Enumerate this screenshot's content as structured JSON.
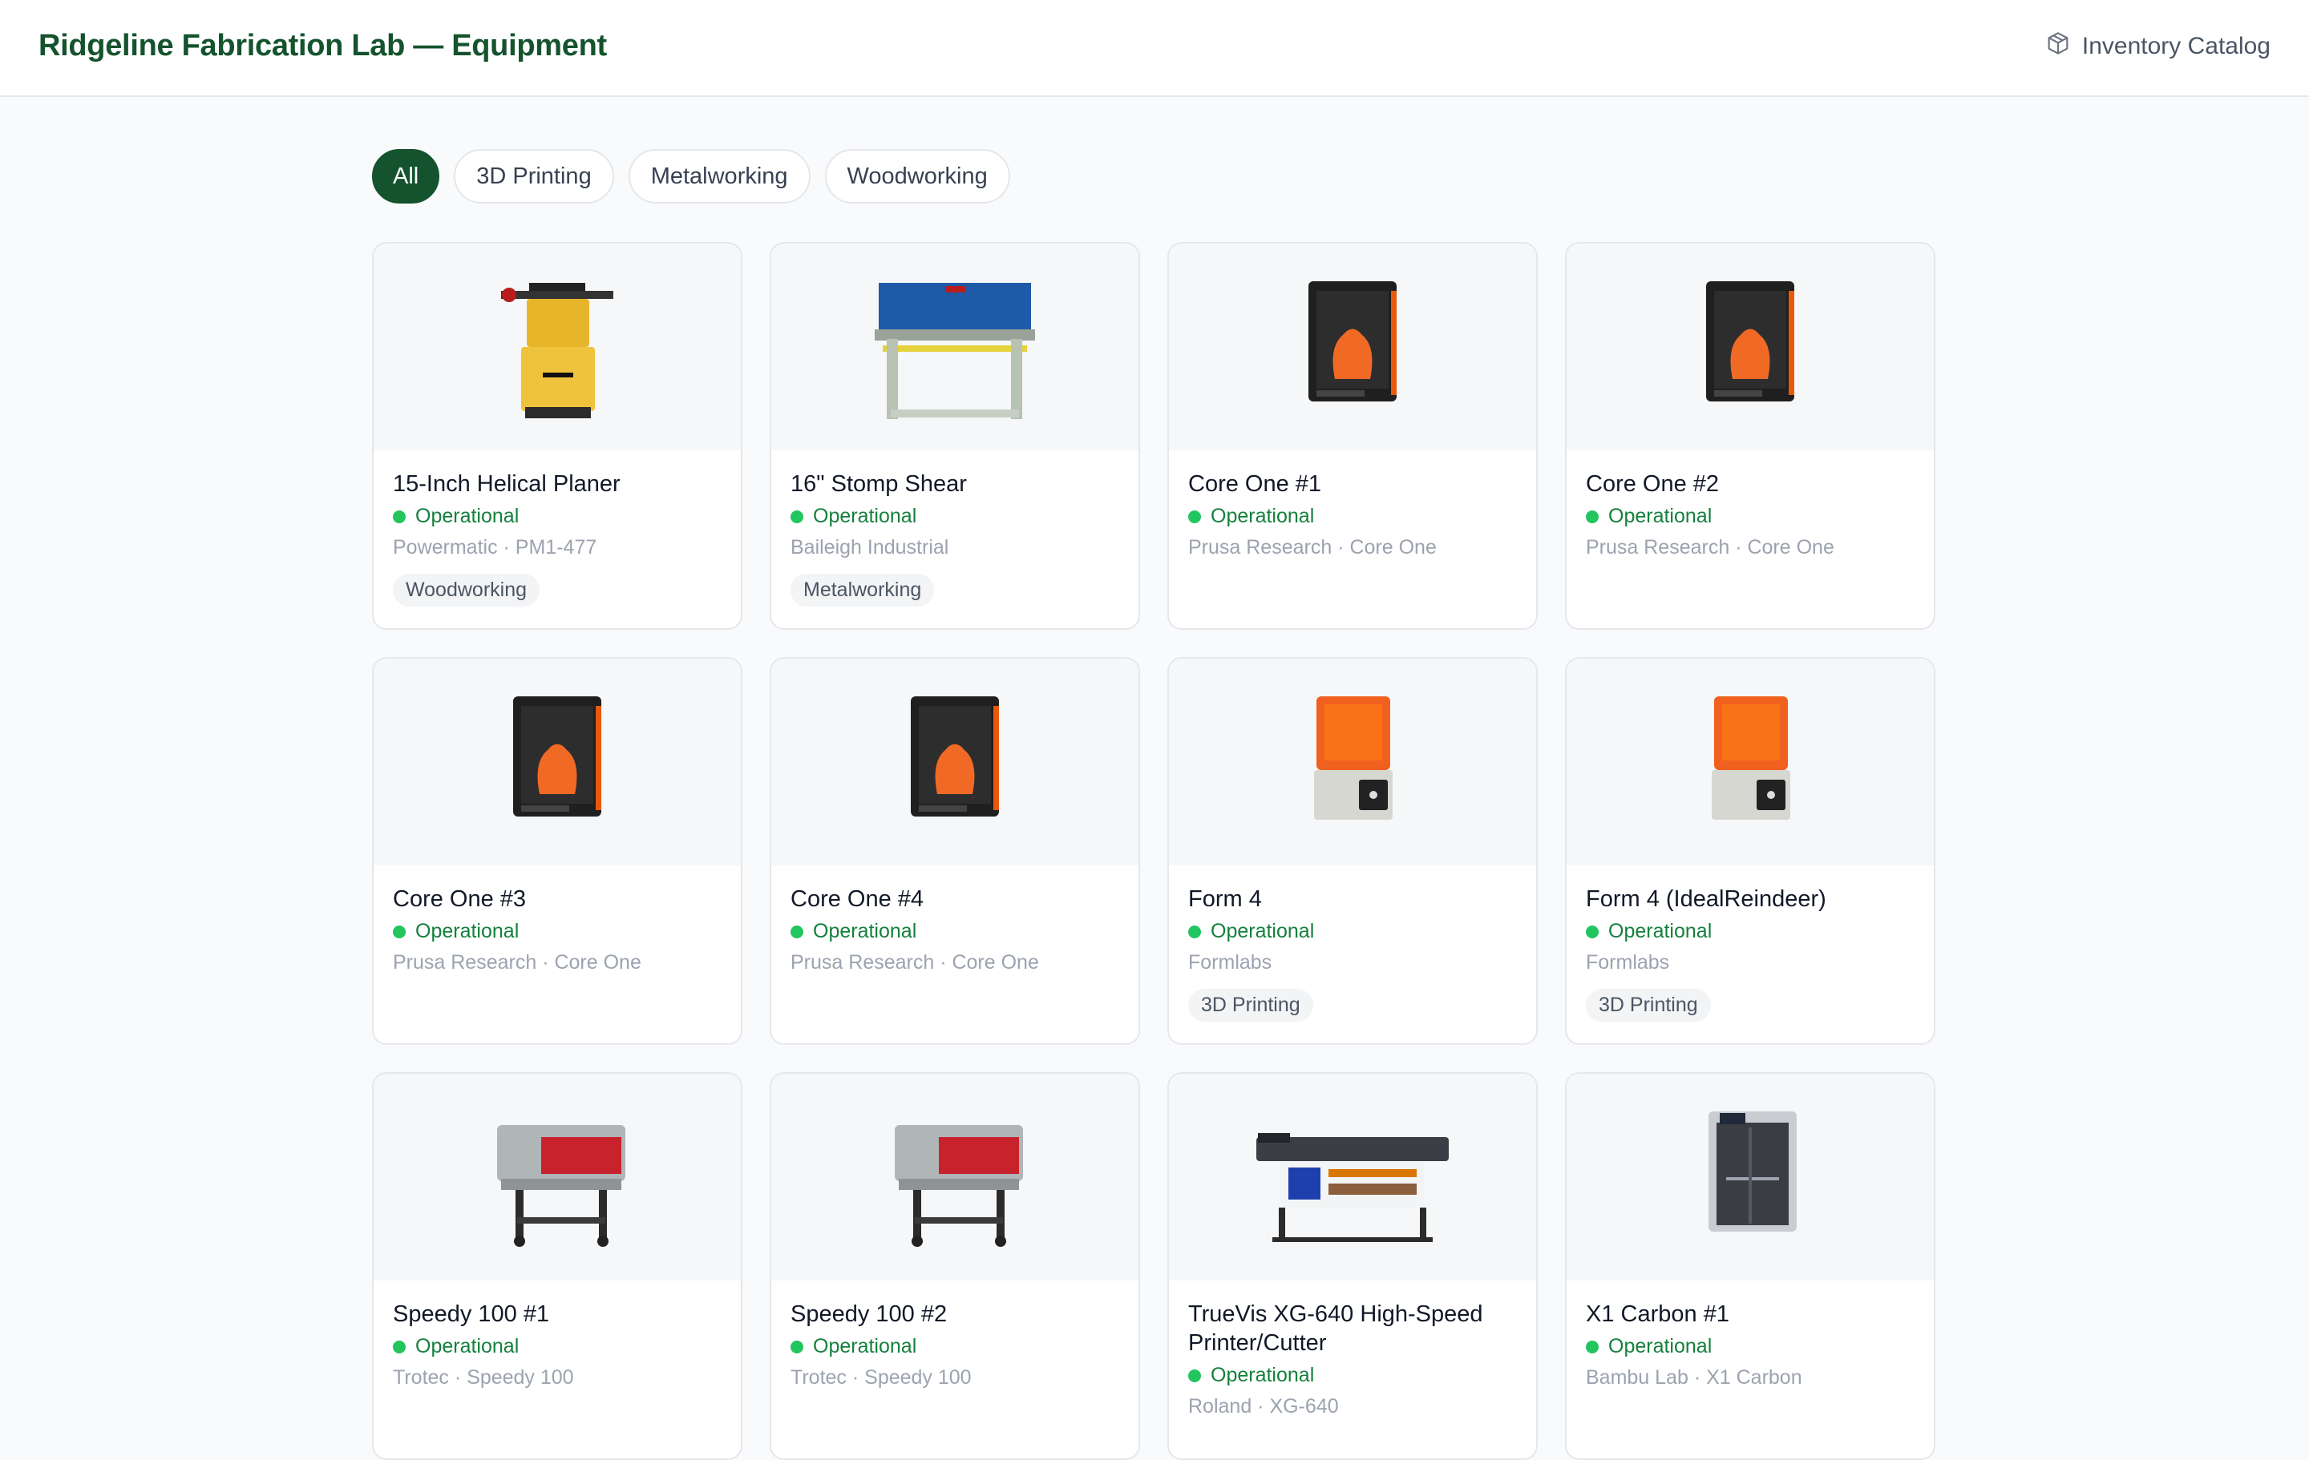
{
  "header": {
    "title": "Ridgeline Fabrication Lab — Equipment",
    "catalog_link": "Inventory Catalog"
  },
  "filters": [
    "All",
    "3D Printing",
    "Metalworking",
    "Woodworking"
  ],
  "active_filter": "All",
  "status_color": "#22c55e",
  "brand_color": "#14532d",
  "equipment": [
    {
      "name": "15-Inch Helical Planer",
      "status": "Operational",
      "maker": "Powermatic · PM1-477",
      "tag": "Woodworking",
      "image": "planer"
    },
    {
      "name": "16\" Stomp Shear",
      "status": "Operational",
      "maker": "Baileigh Industrial",
      "tag": "Metalworking",
      "image": "shear"
    },
    {
      "name": "Core One #1",
      "status": "Operational",
      "maker": "Prusa Research · Core One",
      "tag": "",
      "image": "core-one"
    },
    {
      "name": "Core One #2",
      "status": "Operational",
      "maker": "Prusa Research · Core One",
      "tag": "",
      "image": "core-one"
    },
    {
      "name": "Core One #3",
      "status": "Operational",
      "maker": "Prusa Research · Core One",
      "tag": "",
      "image": "core-one"
    },
    {
      "name": "Core One #4",
      "status": "Operational",
      "maker": "Prusa Research · Core One",
      "tag": "",
      "image": "core-one"
    },
    {
      "name": "Form 4",
      "status": "Operational",
      "maker": "Formlabs",
      "tag": "3D Printing",
      "image": "form4"
    },
    {
      "name": "Form 4 (IdealReindeer)",
      "status": "Operational",
      "maker": "Formlabs",
      "tag": "3D Printing",
      "image": "form4"
    },
    {
      "name": "Speedy 100 #1",
      "status": "Operational",
      "maker": "Trotec · Speedy 100",
      "tag": "",
      "image": "laser"
    },
    {
      "name": "Speedy 100 #2",
      "status": "Operational",
      "maker": "Trotec · Speedy 100",
      "tag": "",
      "image": "laser"
    },
    {
      "name": "TrueVis XG-640 High-Speed Printer/Cutter",
      "status": "Operational",
      "maker": "Roland · XG-640",
      "tag": "",
      "image": "wide-printer"
    },
    {
      "name": "X1 Carbon #1",
      "status": "Operational",
      "maker": "Bambu Lab · X1 Carbon",
      "tag": "",
      "image": "x1-carbon"
    }
  ]
}
